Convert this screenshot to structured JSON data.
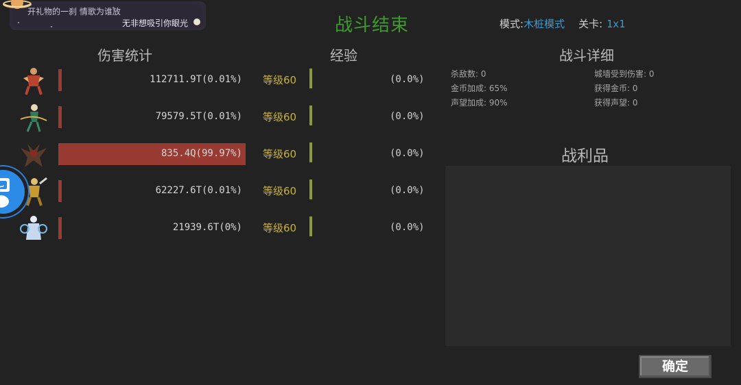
{
  "banner": {
    "line1": "开礼物的一刹 情歌为谁放",
    "line2": "无非想吸引你眼光"
  },
  "title": "战斗结束",
  "mode": {
    "label": "模式:",
    "value": "木桩模式",
    "stage_label": "关卡:",
    "stage_value": "1x1"
  },
  "headers": {
    "damage": "伤害统计",
    "exp": "经验",
    "detail": "战斗详细",
    "loot": "战利品"
  },
  "colors": {
    "title": "#3f9a2e",
    "damage_bar": "#9a3b33",
    "level_text": "#c9b234",
    "level_bar": "#8a9a3a",
    "mode_value": "#3a9bd5"
  },
  "rows": [
    {
      "damage": "112711.9T(0.01%)",
      "share": 0.0001,
      "level": "等级60",
      "exp": "(0.0%)",
      "avatar": "warrior-red-avatar"
    },
    {
      "damage": "79579.5T(0.01%)",
      "share": 0.0001,
      "level": "等级60",
      "exp": "(0.0%)",
      "avatar": "archer-green-avatar"
    },
    {
      "damage": "835.4Q(99.97%)",
      "share": 0.9997,
      "level": "等级60",
      "exp": "(0.0%)",
      "avatar": "dragon-dark-avatar"
    },
    {
      "damage": "62227.6T(0.01%)",
      "share": 0.0001,
      "level": "等级60",
      "exp": "(0.0%)",
      "avatar": "knight-gold-avatar"
    },
    {
      "damage": "21939.6T(0%)",
      "share": 0.0,
      "level": "等级60",
      "exp": "(0.0%)",
      "avatar": "mage-white-avatar"
    }
  ],
  "details": {
    "kills": "杀敌数: 0",
    "wall_damage": "城墙受到伤害: 0",
    "gold_bonus": "金币加成: 65%",
    "gold_gained": "获得金币: 0",
    "fame_bonus": "声望加成: 90%",
    "fame_gained": "获得声望: 0"
  },
  "confirm_label": "确定"
}
